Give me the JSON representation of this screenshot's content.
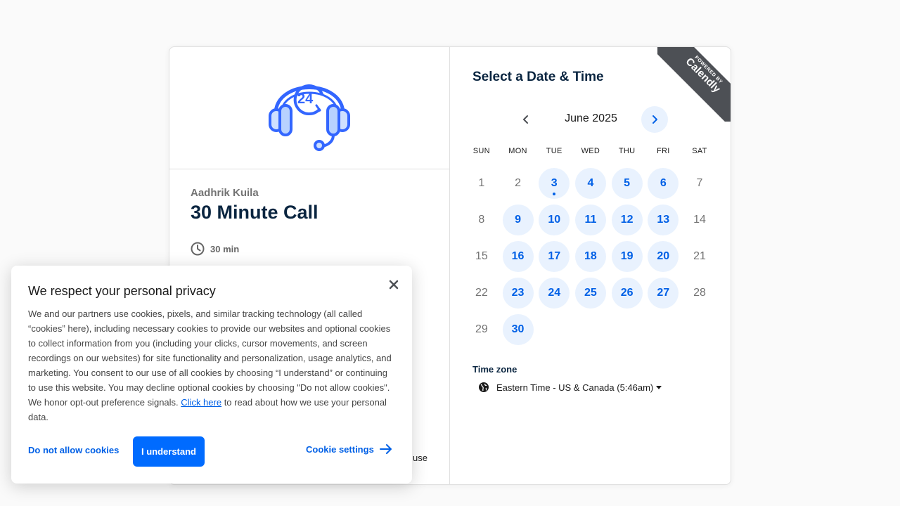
{
  "event": {
    "host": "Aadhrik Kuila",
    "title": "30 Minute Call",
    "duration": "30 min",
    "partial_text": "use"
  },
  "scheduler": {
    "title": "Select a Date & Time",
    "ribbon_small": "POWERED BY",
    "ribbon_brand": "Calendly",
    "month": "June 2025",
    "weekdays": [
      "SUN",
      "MON",
      "TUE",
      "WED",
      "THU",
      "FRI",
      "SAT"
    ],
    "weeks": [
      [
        {
          "d": "1",
          "a": false
        },
        {
          "d": "2",
          "a": false
        },
        {
          "d": "3",
          "a": true,
          "dot": true
        },
        {
          "d": "4",
          "a": true
        },
        {
          "d": "5",
          "a": true
        },
        {
          "d": "6",
          "a": true
        },
        {
          "d": "7",
          "a": false
        }
      ],
      [
        {
          "d": "8",
          "a": false
        },
        {
          "d": "9",
          "a": true
        },
        {
          "d": "10",
          "a": true
        },
        {
          "d": "11",
          "a": true
        },
        {
          "d": "12",
          "a": true
        },
        {
          "d": "13",
          "a": true
        },
        {
          "d": "14",
          "a": false
        }
      ],
      [
        {
          "d": "15",
          "a": false
        },
        {
          "d": "16",
          "a": true
        },
        {
          "d": "17",
          "a": true
        },
        {
          "d": "18",
          "a": true
        },
        {
          "d": "19",
          "a": true
        },
        {
          "d": "20",
          "a": true
        },
        {
          "d": "21",
          "a": false
        }
      ],
      [
        {
          "d": "22",
          "a": false
        },
        {
          "d": "23",
          "a": true
        },
        {
          "d": "24",
          "a": true
        },
        {
          "d": "25",
          "a": true
        },
        {
          "d": "26",
          "a": true
        },
        {
          "d": "27",
          "a": true
        },
        {
          "d": "28",
          "a": false
        }
      ],
      [
        {
          "d": "29",
          "a": false
        },
        {
          "d": "30",
          "a": true
        }
      ]
    ],
    "timezone_label": "Time zone",
    "timezone_value": "Eastern Time - US & Canada (5:46am)"
  },
  "cookie_banner": {
    "title": "We respect your personal privacy",
    "body": "We and our partners use cookies, pixels, and similar tracking technology (all called “cookies” here), including necessary cookies to provide our websites and optional cookies to collect information from you (including your clicks, cursor movements, and screen recordings on our websites) for site functionality and personalization, usage analytics, and marketing. You consent to our use of all cookies by choosing “I understand” or continuing to use this website. You may decline optional cookies by choosing \"Do not allow cookies\". We honor opt-out preference signals. ",
    "link_text": "Click here",
    "body_tail": " to read about how we use your personal data.",
    "deny_label": "Do not allow cookies",
    "accept_label": "I understand",
    "settings_label": "Cookie settings"
  },
  "colors": {
    "accent": "#006bff",
    "available_bg": "#e9f2fe",
    "available_text": "#0060e6",
    "ribbon": "#4d5055"
  },
  "icons": {
    "logo": "headset-24-icon",
    "duration": "clock-icon",
    "prev": "chevron-left-icon",
    "next": "chevron-right-icon",
    "timezone": "globe-icon",
    "close": "close-icon",
    "settings": "arrow-right-icon"
  }
}
